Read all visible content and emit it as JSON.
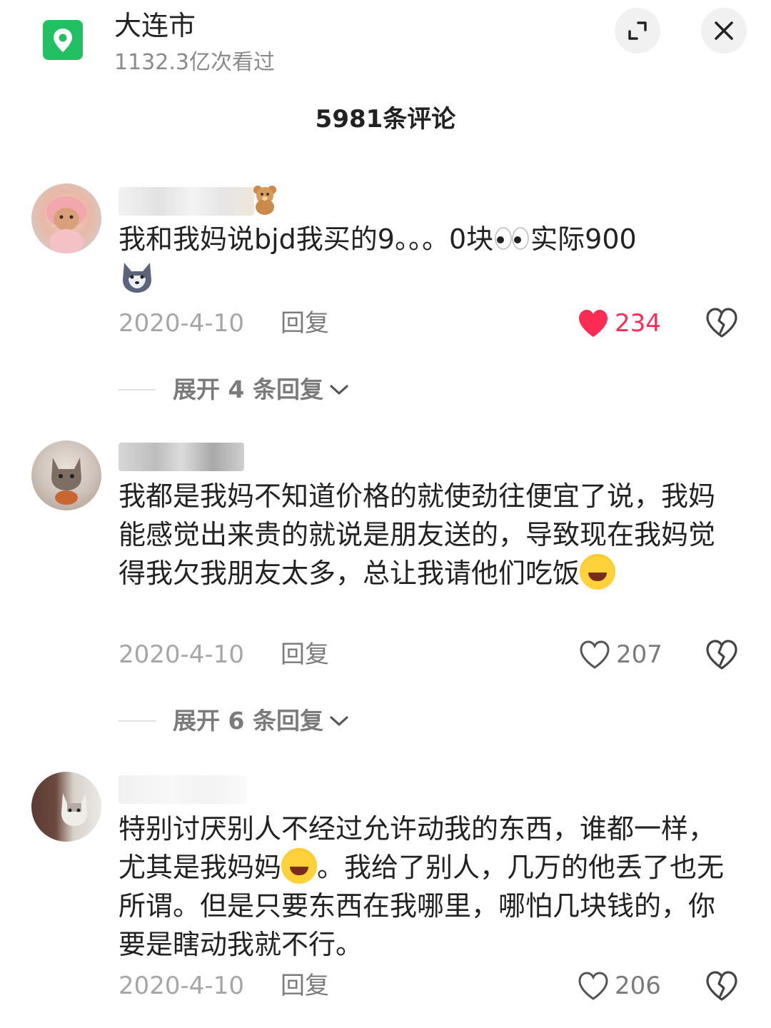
{
  "header": {
    "location_title": "大连市",
    "views": "1132.3亿次看过",
    "comment_count": "5981条评论"
  },
  "icons": {
    "location": "location-pin-icon",
    "expand": "expand-icon",
    "close": "close-icon",
    "like": "heart-icon",
    "dislike": "broken-heart-icon",
    "chevron": "chevron-down-icon"
  },
  "colors": {
    "accent_green": "#21c063",
    "liked_red": "#fe2c55",
    "muted_text": "#a6a6a6"
  },
  "comments": [
    {
      "text_a": "我和我妈说bjd我买的9。。。0块",
      "text_b": "实际900",
      "date": "2020-4-10",
      "reply_label": "回复",
      "likes": "234",
      "liked": true,
      "expand_label": "展开 4 条回复"
    },
    {
      "text_a": "我都是我妈不知道价格的就使劲往便宜了说，我妈能感觉出来贵的就说是朋友送的，导致现在我妈觉得我欠我朋友太多，总让我请他们吃饭",
      "date": "2020-4-10",
      "reply_label": "回复",
      "likes": "207",
      "liked": false,
      "expand_label": "展开 6 条回复"
    },
    {
      "text_a": "特别讨厌别人不经过允许动我的东西，谁都一样，尤其是我妈妈",
      "text_b": "。我给了别人，几万的他丢了也无所谓。但是只要东西在我哪里，哪怕几块钱的，你要是瞎动我就不行。",
      "date": "2020-4-10",
      "reply_label": "回复",
      "likes": "206",
      "liked": false
    }
  ]
}
